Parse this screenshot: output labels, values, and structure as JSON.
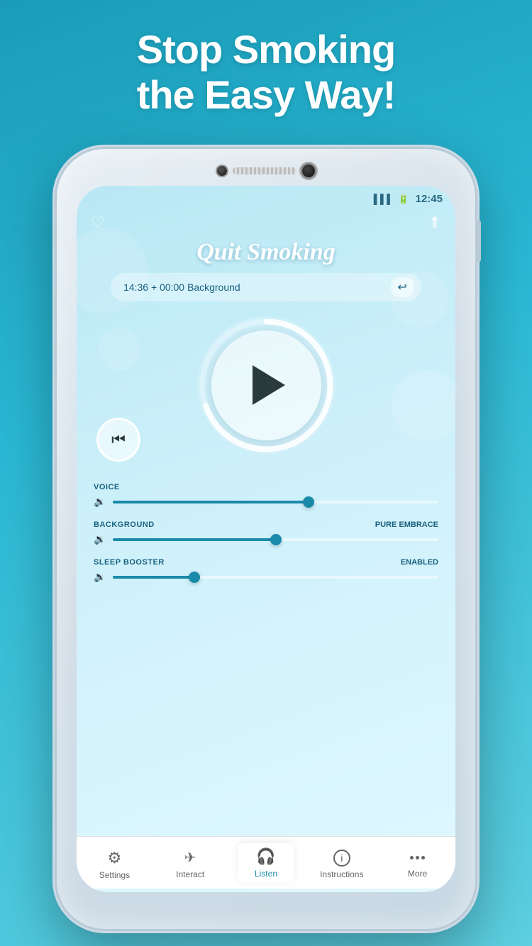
{
  "header": {
    "title_line1": "Stop Smoking",
    "title_line2": "the Easy Way!"
  },
  "status_bar": {
    "time": "12:45"
  },
  "app": {
    "title": "Quit Smoking",
    "duration": "14:36 + 00:00 Background",
    "loop_icon": "↩",
    "heart_icon": "♡",
    "share_icon": "⬆"
  },
  "sliders": {
    "voice": {
      "label": "VOICE",
      "value": "",
      "fill_pct": 60
    },
    "background": {
      "label": "BACKGROUND",
      "value": "PURE EMBRACE",
      "fill_pct": 50
    },
    "sleep_booster": {
      "label": "SLEEP BOOSTER",
      "value": "ENABLED",
      "fill_pct": 25
    }
  },
  "nav": {
    "items": [
      {
        "id": "settings",
        "label": "Settings",
        "icon": "⚙",
        "active": false
      },
      {
        "id": "interact",
        "label": "Interact",
        "icon": "✈",
        "active": false
      },
      {
        "id": "listen",
        "label": "Listen",
        "icon": "🎧",
        "active": true
      },
      {
        "id": "instructions",
        "label": "Instructions",
        "icon": "ℹ",
        "active": false
      },
      {
        "id": "more",
        "label": "More",
        "icon": "...",
        "active": false
      }
    ]
  }
}
